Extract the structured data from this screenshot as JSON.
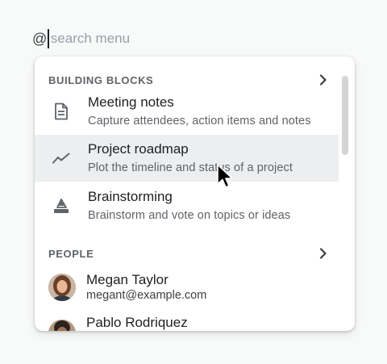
{
  "search": {
    "prefix": "@",
    "placeholder": "search menu",
    "value": ""
  },
  "sections": {
    "building_blocks": {
      "title": "BUILDING BLOCKS",
      "items": [
        {
          "title": "Meeting notes",
          "description": "Capture attendees, action items and notes",
          "icon": "document-icon"
        },
        {
          "title": "Project roadmap",
          "description": "Plot the timeline and status of a project",
          "icon": "trend-line-icon",
          "highlighted": true
        },
        {
          "title": "Brainstorming",
          "description": "Brainstorm and vote on topics or ideas",
          "icon": "eraser-icon"
        }
      ]
    },
    "people": {
      "title": "PEOPLE",
      "items": [
        {
          "name": "Megan Taylor",
          "email": "megant@example.com"
        },
        {
          "name": "Pablo Rodriquez"
        }
      ]
    }
  },
  "colors": {
    "highlight": "#eceeef",
    "menu_bg": "#ffffff",
    "page_bg": "#f8f9f9",
    "secondary_text": "#5f6368"
  }
}
